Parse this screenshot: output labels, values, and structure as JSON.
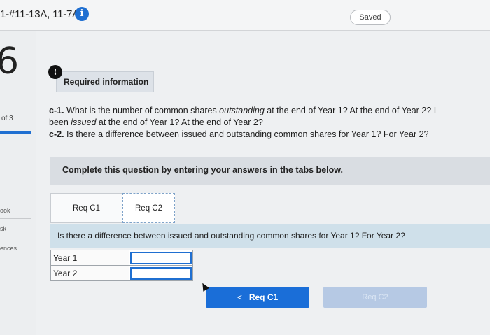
{
  "header": {
    "assignment_title": "1-#11-13A, 11-7A",
    "info_glyph": "i",
    "saved_label": "Saved"
  },
  "left_rail": {
    "question_number": "6",
    "question_of": "of 3",
    "links": [
      "ook",
      "sk",
      "ences"
    ]
  },
  "required_info": {
    "icon_glyph": "!",
    "label": "Required information"
  },
  "question": {
    "c1_label": "c-1.",
    "c1_line1_a": " What is the number of common shares ",
    "c1_line1_em": "outstanding",
    "c1_line1_b": " at the end of Year 1? At the end of Year 2? I",
    "c1_line2_a": "been ",
    "c1_line2_em": "issued",
    "c1_line2_b": " at the end of Year 1? At the end of Year 2?",
    "c2_label": "c-2.",
    "c2_text": " Is there a difference between issued and outstanding common shares for Year 1? For Year 2?"
  },
  "instructions": "Complete this question by entering your answers in the tabs below.",
  "tabs": [
    {
      "label": "Req C1"
    },
    {
      "label": "Req C2"
    }
  ],
  "panel": {
    "prompt": "Is there a difference between issued and outstanding common shares for Year 1? For Year 2?",
    "rows": [
      {
        "label": "Year 1",
        "value": ""
      },
      {
        "label": "Year 2",
        "value": ""
      }
    ]
  },
  "navigation": {
    "prev_chevron": "<",
    "prev_label": "Req C1",
    "next_label": "Req C2"
  }
}
